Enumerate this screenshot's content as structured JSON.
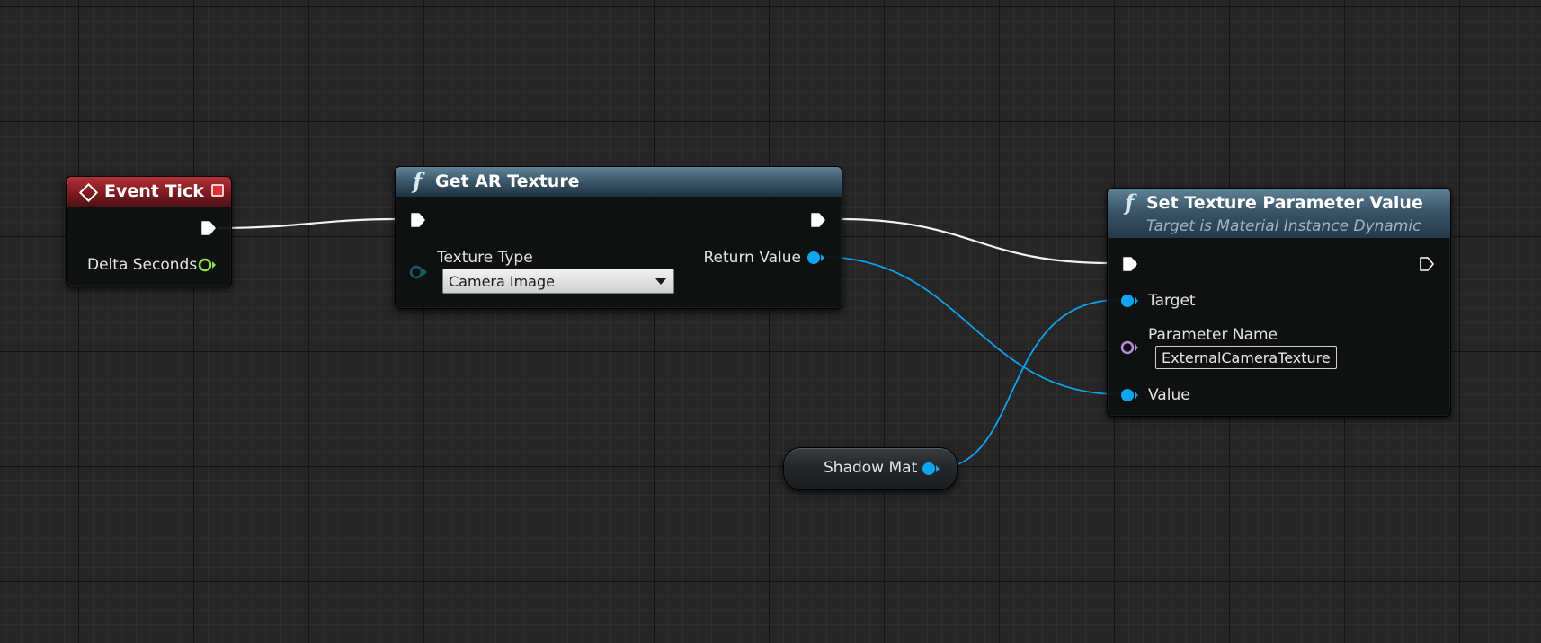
{
  "colors": {
    "exec": "#ffffff",
    "object_pin": "#0ea4ef",
    "float_pin": "#8ee24e",
    "name_pin": "#b58cd8",
    "enum_pin": "#155e5e",
    "event_header": "#7e1b20",
    "function_header": "#3a5669"
  },
  "event_tick": {
    "title": "Event Tick",
    "icon": "event-diamond-icon",
    "outputs": [
      {
        "type": "exec"
      },
      {
        "label": "Delta Seconds",
        "type": "float"
      }
    ]
  },
  "get_ar_texture": {
    "title": "Get AR Texture",
    "icon": "function-icon",
    "inputs": [
      {
        "type": "exec"
      },
      {
        "label": "Texture Type",
        "type": "enum",
        "value": "Camera Image"
      }
    ],
    "outputs": [
      {
        "type": "exec"
      },
      {
        "label": "Return Value",
        "type": "object"
      }
    ]
  },
  "set_texture_param": {
    "title": "Set Texture Parameter Value",
    "subtitle": "Target is Material Instance Dynamic",
    "icon": "function-icon",
    "inputs": [
      {
        "type": "exec"
      },
      {
        "label": "Target",
        "type": "object"
      },
      {
        "label": "Parameter Name",
        "type": "name",
        "value": "ExternalCameraTexture"
      },
      {
        "label": "Value",
        "type": "object"
      }
    ],
    "outputs": [
      {
        "type": "exec"
      }
    ]
  },
  "shadow_mat": {
    "label": "Shadow Mat",
    "type": "object"
  }
}
